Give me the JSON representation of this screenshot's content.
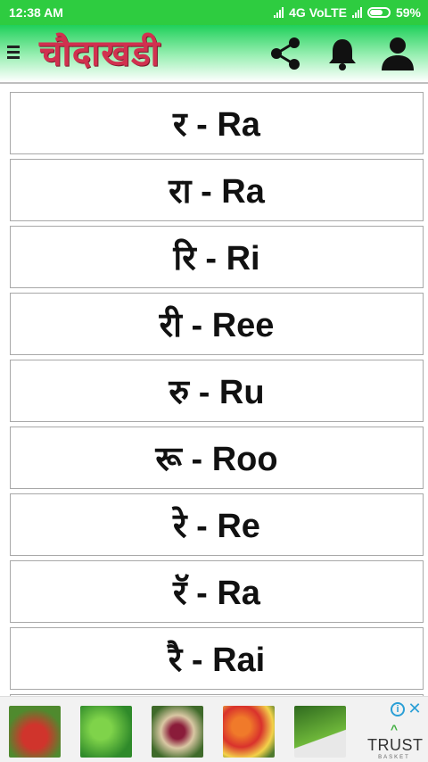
{
  "status": {
    "time": "12:38 AM",
    "network": "4G VoLTE",
    "battery": "59%"
  },
  "app_bar": {
    "title": "चौदाखडी",
    "icons": [
      "menu-icon",
      "share-icon",
      "bell-icon",
      "user-icon"
    ]
  },
  "items": [
    {
      "label": "र - Ra"
    },
    {
      "label": "रा - Ra"
    },
    {
      "label": "रि - Ri"
    },
    {
      "label": "री - Ree"
    },
    {
      "label": "रु - Ru"
    },
    {
      "label": "रू - Roo"
    },
    {
      "label": "रे - Re"
    },
    {
      "label": "रॅ - Ra"
    },
    {
      "label": "रै - Rai"
    }
  ],
  "ad": {
    "brand_mark": "^",
    "brand_word": "TRUST",
    "brand_sub": "BASKET",
    "choice_icon": "i",
    "close_icon": "✕"
  },
  "colors": {
    "status_bar": "#2ecc40",
    "title": "#d1314f",
    "item_border": "#a8a8a8"
  }
}
